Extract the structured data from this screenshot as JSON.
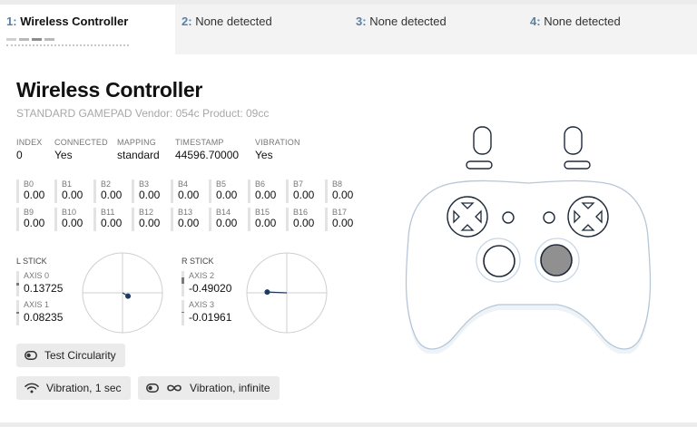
{
  "tabs": [
    {
      "num": "1:",
      "label": "Wireless Controller"
    },
    {
      "num": "2:",
      "label": "None detected"
    },
    {
      "num": "3:",
      "label": "None detected"
    },
    {
      "num": "4:",
      "label": "None detected"
    }
  ],
  "controller": {
    "name": "Wireless Controller",
    "subtitle": "STANDARD GAMEPAD Vendor: 054c Product: 09cc"
  },
  "info": {
    "index_label": "INDEX",
    "index": "0",
    "connected_label": "CONNECTED",
    "connected": "Yes",
    "mapping_label": "MAPPING",
    "mapping": "standard",
    "timestamp_label": "TIMESTAMP",
    "timestamp": "44596.70000",
    "vibration_label": "VIBRATION",
    "vibration": "Yes"
  },
  "buttons": [
    {
      "label": "B0",
      "value": "0.00"
    },
    {
      "label": "B1",
      "value": "0.00"
    },
    {
      "label": "B2",
      "value": "0.00"
    },
    {
      "label": "B3",
      "value": "0.00"
    },
    {
      "label": "B4",
      "value": "0.00"
    },
    {
      "label": "B5",
      "value": "0.00"
    },
    {
      "label": "B6",
      "value": "0.00"
    },
    {
      "label": "B7",
      "value": "0.00"
    },
    {
      "label": "B8",
      "value": "0.00"
    },
    {
      "label": "B9",
      "value": "0.00"
    },
    {
      "label": "B10",
      "value": "0.00"
    },
    {
      "label": "B11",
      "value": "0.00"
    },
    {
      "label": "B12",
      "value": "0.00"
    },
    {
      "label": "B13",
      "value": "0.00"
    },
    {
      "label": "B14",
      "value": "0.00"
    },
    {
      "label": "B15",
      "value": "0.00"
    },
    {
      "label": "B16",
      "value": "0.00"
    },
    {
      "label": "B17",
      "value": "0.00"
    }
  ],
  "lstick": {
    "label": "L STICK",
    "axis0_label": "AXIS 0",
    "axis0": "0.13725",
    "axis0_value": 0.13725,
    "axis1_label": "AXIS 1",
    "axis1": "0.08235",
    "axis1_value": 0.08235
  },
  "rstick": {
    "label": "R STICK",
    "axis2_label": "AXIS 2",
    "axis2": "-0.49020",
    "axis2_value": -0.4902,
    "axis3_label": "AXIS 3",
    "axis3": "-0.01961",
    "axis3_value": -0.01961
  },
  "actions": {
    "test_circularity": "Test Circularity",
    "vibration_1sec": "Vibration, 1 sec",
    "vibration_infinite": "Vibration, infinite"
  },
  "icons": {
    "toggle": "toggle-icon",
    "wifi": "wifi-icon",
    "infinity": "infinity-icon"
  },
  "colors": {
    "tab_number": "#5a7fa8",
    "pressed_fill": "#909090",
    "stick_dot": "#1e3a5f"
  }
}
